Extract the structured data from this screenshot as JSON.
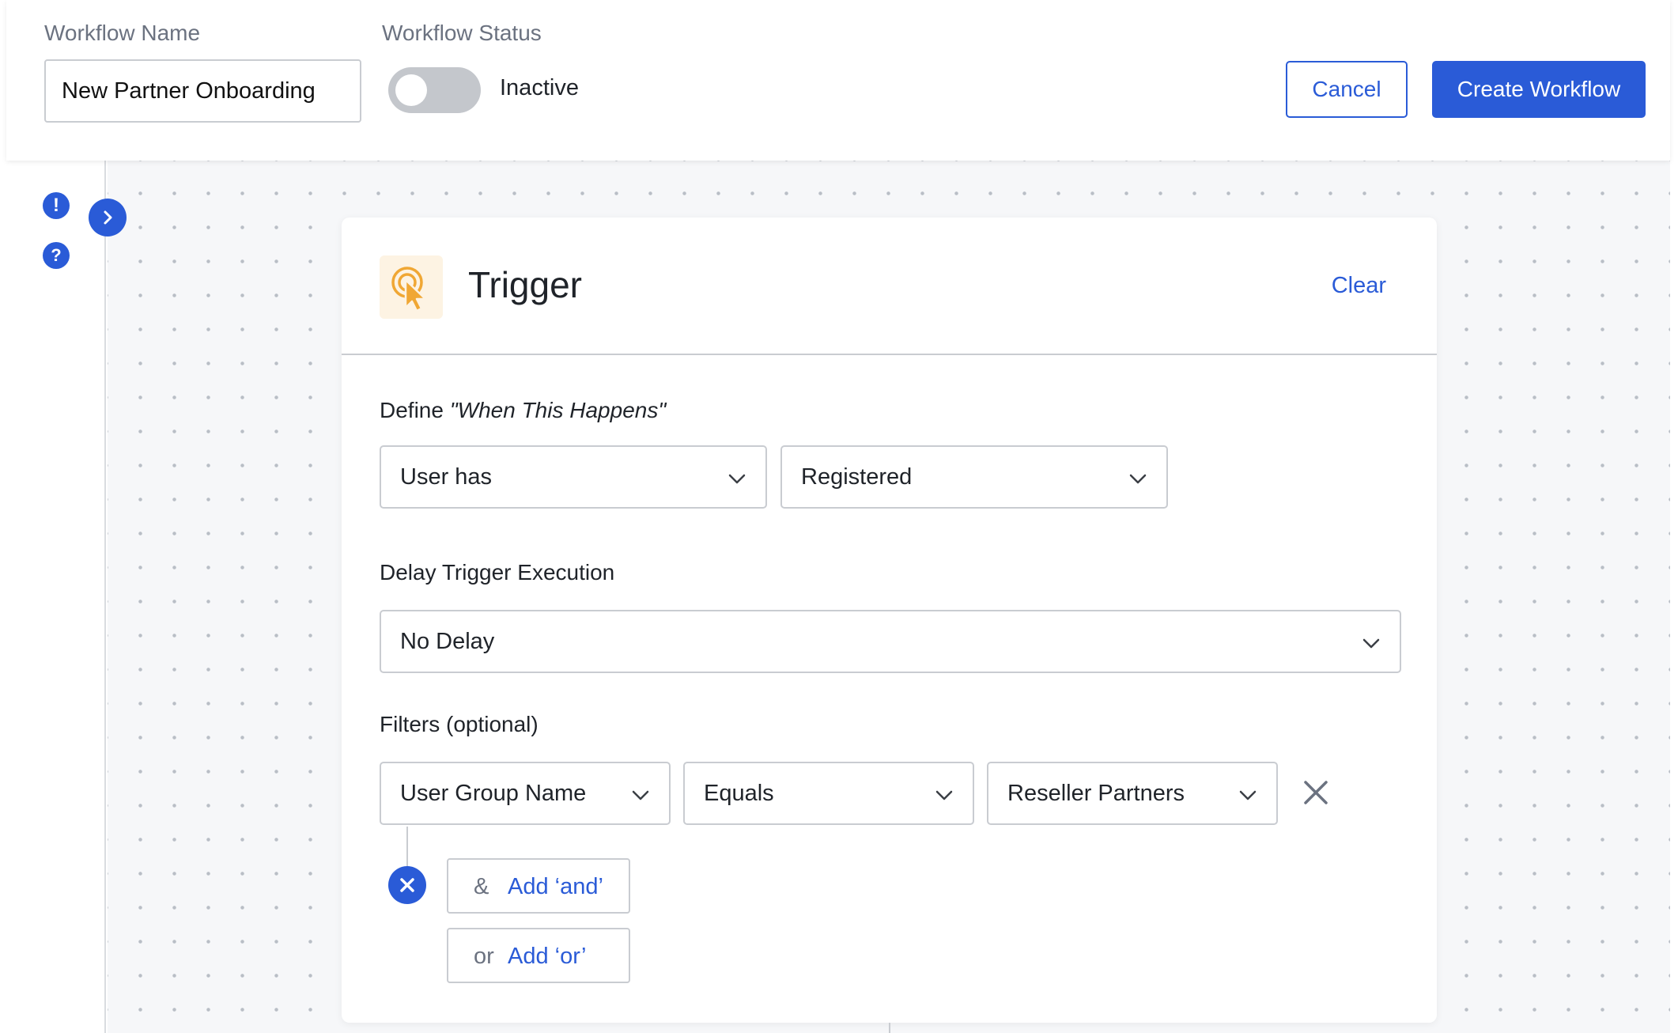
{
  "header": {
    "workflow_name_label": "Workflow Name",
    "workflow_name_value": "New Partner Onboarding",
    "workflow_status_label": "Workflow Status",
    "status_text": "Inactive",
    "status_active": false,
    "cancel_label": "Cancel",
    "create_label": "Create Workflow"
  },
  "rail": {
    "alert_icon": "exclamation-icon",
    "help_icon": "question-icon",
    "expand_icon": "chevron-right-icon"
  },
  "trigger": {
    "title": "Trigger",
    "icon": "cursor-click-icon",
    "clear_label": "Clear",
    "define_prefix": "Define ",
    "define_emphasis": "\"When This Happens\"",
    "subject_select": "User has",
    "event_select": "Registered",
    "delay_label": "Delay Trigger Execution",
    "delay_select": "No Delay",
    "filters_label": "Filters (optional)",
    "filter": {
      "field": "User Group Name",
      "operator": "Equals",
      "value": "Reseller Partners"
    },
    "add_and_symbol": "&",
    "add_and_label": "Add ‘and’",
    "add_or_symbol": "or",
    "add_or_label": "Add ‘or’"
  },
  "colors": {
    "accent": "#2a5bd7",
    "toggle_off": "#c4c7cc",
    "trigger_icon": "#f0a734",
    "trigger_icon_bg": "#fdf3e3"
  }
}
